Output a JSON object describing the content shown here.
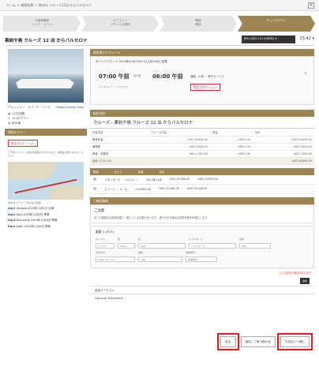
{
  "crumbs": "ホーム ＞ 検索結果 ＞ 欧州の  クルーズ12泊 からバルセロナ",
  "steps": [
    {
      "title": "お客様情報",
      "sub": "シング ・ナーム"
    },
    {
      "title": "カテゴリー",
      "sub": "バランスの選択"
    },
    {
      "title": "確認",
      "sub": "確認"
    },
    {
      "title": "チェックアウト",
      "sub": ""
    }
  ],
  "page_title": "果紛や島 クルーズ 12 泊 からバルセロナ",
  "currency": "JPN (USD 111.4963B) ▾",
  "clock": "13:42 ▾",
  "ship_caption": "ヴォイジャー・オブ・ザ・シーズ",
  "brand": "Regent Seven Seas",
  "facts": [
    "12泊日間",
    "22:00アワー",
    "地中海"
  ],
  "promo_head": "特別オファー",
  "promo_chip": "早割プロモーション",
  "promo_text": "ご予約いただくと追加の特典が付与されます。詳細はお問い合わせください。",
  "map_caption": "地中海・アドリア海を巡る航路",
  "days": [
    {
      "day": "Day1",
      "text": "Venezia  2023年11月1日 出港"
    },
    {
      "day": "Day2",
      "text": "Split  2023年11月3日 寄港"
    },
    {
      "day": "Day3",
      "text": "Dubrovnik  2023年11月4日 寄港"
    },
    {
      "day": "Day4",
      "text": "Kotor  2023年11月5日 寄港"
    }
  ],
  "flight": {
    "head": "航空券スケジュール",
    "row1": "ターンアラウンド  2023年11月1日から11月13日に到着",
    "dep": "07:00 午前",
    "mid": "直行便",
    "arr": "06:00 午前",
    "meta": "通路 - 4 席  ・ 受付サービス",
    "tag": "早割プロモーション",
    "tiny": "ヴェネツィア  →  バルセロナ",
    "collapse": "∧"
  },
  "price_section_head": "料金内訳",
  "cruise_title": "クルーズ - 果紛や島 クルーズ 12 泊 からバルセロナ",
  "price_header": [
    "料金内訳",
    "クルーズ料金",
    "税金",
    "合計"
  ],
  "price_rows": [
    [
      "基本料金",
      "USD 19,900.00",
      "USD 0.00",
      "USD 19,900.00"
    ],
    [
      "港湾税",
      "USD 3,900.00",
      "USD 0.00",
      "USD 3,900.00"
    ],
    [
      "税金・手数料",
      "USD 1,090.00",
      "USD 0.00",
      "USD 1,090.00"
    ],
    [
      "合計 (バランス)",
      "",
      "",
      "USD 24,890.00"
    ]
  ],
  "pax_head": [
    "客室",
    "タイプ",
    "料金",
    "合計"
  ],
  "pax_rows": [
    [
      "スタンダード ・ バルコニー",
      "2023年11月",
      "USD 19,900.00",
      "USD 19,900.00"
    ],
    [
      "スイート ・ ルーム",
      "2023年11月",
      "USD 19,900.00",
      "USD 19,900.00"
    ]
  ],
  "notice_head": "ご確認事項",
  "notice_title": "ご注意",
  "notice_body": "全ての乗客名は旅券記載と一致している必要があります。誤りがある場合は変更手数料が発生します。",
  "form_title": "乗客 1 (大人)",
  "form_labels": [
    "タイトル",
    "姓",
    "名",
    "ミドルネーム",
    "性別"
  ],
  "form_values": [
    "ミスター",
    "Alexis",
    "名前",
    "ミドルネーム",
    "男性"
  ],
  "form_labels2": [
    "生年月日",
    "国籍",
    "旅券番号"
  ],
  "form_values2": [
    "1980 / 01 / 01",
    "日本",
    "旅券番号"
  ],
  "red_note": "ご入力必須の項目があります",
  "add_label": "追加",
  "accordions": [
    "追加サービス ▸",
    "Optional Activities ▸"
  ],
  "buttons": {
    "back": "戻る",
    "save": "保存して後で続ける",
    "next": "お支払いへ進む"
  },
  "colors": {
    "accent": "#9c8553",
    "highlight": "#e21b1b"
  }
}
